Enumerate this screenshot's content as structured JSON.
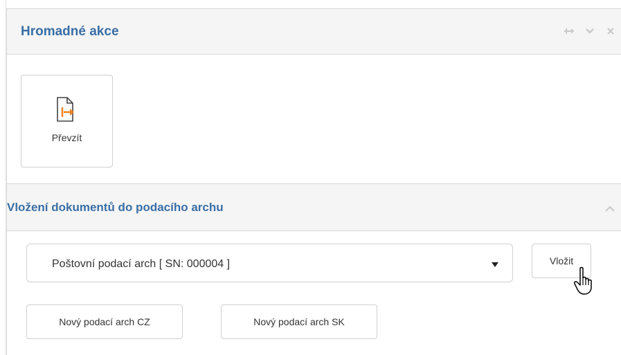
{
  "panel": {
    "title": "Hromadné akce",
    "tools": [
      "pin-icon",
      "chevron-down-icon",
      "close-icon"
    ]
  },
  "actions": {
    "tiles": [
      {
        "label": "Převzít",
        "icon": "take-over-document-icon"
      }
    ]
  },
  "section": {
    "title": "Vložení dokumentů do podacího archu",
    "toggle_icon": "chevron-up-icon"
  },
  "form": {
    "select_value": "Poštovní podací arch [ SN: 000004 ]",
    "insert_label": "Vložit",
    "new_cz_label": "Nový podací arch CZ",
    "new_sk_label": "Nový podací arch SK"
  },
  "colors": {
    "title_blue": "#3a6ea5",
    "icon_orange": "#f0821e",
    "header_bg": "#f5f5f5"
  }
}
